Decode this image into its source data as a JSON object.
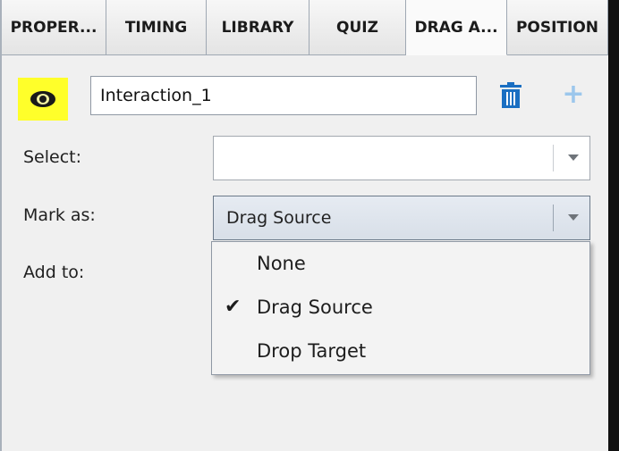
{
  "tabs": [
    {
      "label": "PROPER...",
      "active": false
    },
    {
      "label": "TIMING",
      "active": false
    },
    {
      "label": "LIBRARY",
      "active": false
    },
    {
      "label": "QUIZ",
      "active": false
    },
    {
      "label": "DRAG A...",
      "active": true
    },
    {
      "label": "POSITION",
      "active": false
    }
  ],
  "interaction": {
    "name_value": "Interaction_1",
    "eye_icon": "eye-icon",
    "delete_icon": "trash-icon",
    "add_icon": "plus-icon",
    "highlight_color": "#ffff2a",
    "delete_color": "#1a6fc2",
    "add_color": "#9cc7ec"
  },
  "form": {
    "select_label": "Select:",
    "select_value": "",
    "mark_as_label": "Mark as:",
    "mark_as_value": "Drag Source",
    "add_to_label": "Add to:"
  },
  "dropdown": {
    "options": [
      {
        "label": "None",
        "checked": false
      },
      {
        "label": "Drag Source",
        "checked": true
      },
      {
        "label": "Drop Target",
        "checked": false
      }
    ],
    "check_glyph": "✔"
  }
}
